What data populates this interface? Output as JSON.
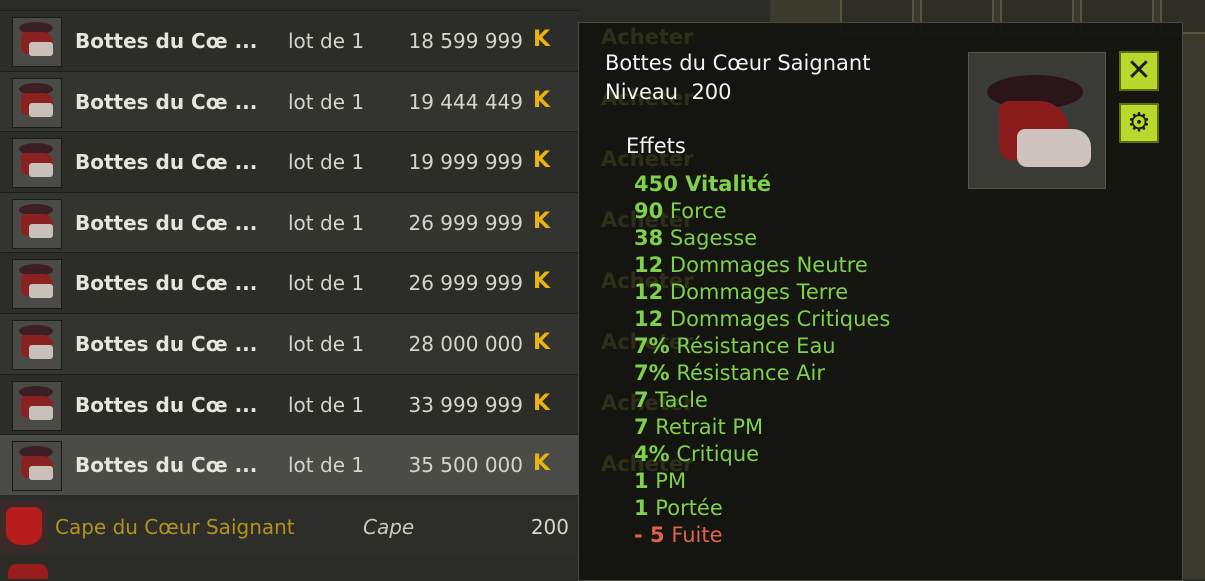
{
  "listings": [
    {
      "name": "Bottes du Cœ…",
      "name_display": "Bottes du Cœ ...",
      "lot": "lot de 1",
      "price": "18 599 999"
    },
    {
      "name": "Bottes du Cœ…",
      "name_display": "Bottes du Cœ ...",
      "lot": "lot de 1",
      "price": "19 444 449"
    },
    {
      "name": "Bottes du Cœ…",
      "name_display": "Bottes du Cœ ...",
      "lot": "lot de 1",
      "price": "19 999 999"
    },
    {
      "name": "Bottes du Cœ…",
      "name_display": "Bottes du Cœ ...",
      "lot": "lot de 1",
      "price": "26 999 999"
    },
    {
      "name": "Bottes du Cœ…",
      "name_display": "Bottes du Cœ ...",
      "lot": "lot de 1",
      "price": "26 999 999"
    },
    {
      "name": "Bottes du Cœ…",
      "name_display": "Bottes du Cœ ...",
      "lot": "lot de 1",
      "price": "28 000 000"
    },
    {
      "name": "Bottes du Cœ…",
      "name_display": "Bottes du Cœ ...",
      "lot": "lot de 1",
      "price": "33 999 999"
    },
    {
      "name": "Bottes du Cœ…",
      "name_display": "Bottes du Cœ ...",
      "lot": "lot de 1",
      "price": "35 500 000"
    }
  ],
  "currency_symbol": "K",
  "currency_color": "#e9b311",
  "cape_row": {
    "name": "Cape du Cœur Saignant",
    "type": "Cape",
    "level": "200"
  },
  "tooltip": {
    "title": "Bottes du Cœur Saignant",
    "level_label": "Niveau",
    "level_value": "200",
    "effects_label": "Effets",
    "buy_label": "Acheter",
    "effects": [
      {
        "value": "450",
        "label": "Vitalité",
        "bold_all": true
      },
      {
        "value": "90",
        "label": "Force"
      },
      {
        "value": "38",
        "label": "Sagesse"
      },
      {
        "value": "12",
        "label": "Dommages Neutre"
      },
      {
        "value": "12",
        "label": "Dommages Terre"
      },
      {
        "value": "12",
        "label": "Dommages Critiques"
      },
      {
        "value": "7%",
        "label": "Résistance Eau"
      },
      {
        "value": "7%",
        "label": "Résistance Air"
      },
      {
        "value": "7",
        "label": "Tacle"
      },
      {
        "value": "7",
        "label": "Retrait PM"
      },
      {
        "value": "4%",
        "label": "Critique"
      },
      {
        "value": "1",
        "label": "PM"
      },
      {
        "value": "1",
        "label": "Portée"
      },
      {
        "value": "- 5",
        "label": "Fuite",
        "negative": true
      }
    ]
  },
  "colors": {
    "positive": "#7fd04a",
    "negative": "#e0644a",
    "accent_button": "#b8d82c"
  },
  "icons": {
    "close": "close-icon",
    "settings": "gear-icon"
  }
}
